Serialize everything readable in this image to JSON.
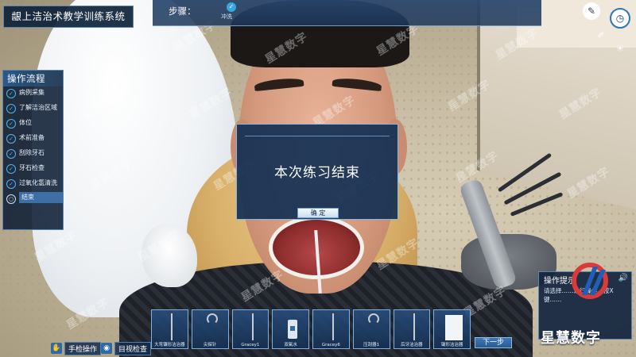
{
  "app": {
    "title": "龈上洁治术教学训练系统"
  },
  "steps": {
    "label": "步骤：",
    "current": "冲洗"
  },
  "procedure": {
    "title": "操作流程",
    "items": [
      {
        "label": "病例采集",
        "done": true
      },
      {
        "label": "了解洁治区域",
        "done": true
      },
      {
        "label": "体位",
        "done": true
      },
      {
        "label": "术前准备",
        "done": true
      },
      {
        "label": "刮除牙石",
        "done": true
      },
      {
        "label": "牙石检查",
        "done": true
      },
      {
        "label": "过氧化氢清洗",
        "done": true
      },
      {
        "label": "结束",
        "done": false,
        "active": true
      }
    ]
  },
  "dialog": {
    "message": "本次练习结束",
    "ok_label": "确 定"
  },
  "tip": {
    "title": "操作提示",
    "text": "请选择……进行操作，按X键……"
  },
  "brand": {
    "name": "星慧数字"
  },
  "tray": {
    "items": [
      {
        "label": "大弯镰形洁治器",
        "icon": "sickle-scaler-icon"
      },
      {
        "label": "尖探针",
        "icon": "probe-icon"
      },
      {
        "label": "Gracey1",
        "icon": "curette-icon"
      },
      {
        "label": "双氧水",
        "icon": "bottle-icon"
      },
      {
        "label": "Gracey6",
        "icon": "curette-icon"
      },
      {
        "label": "压刮器1",
        "icon": "scraper-icon"
      },
      {
        "label": "后牙洁治器",
        "icon": "scaler-icon"
      },
      {
        "label": "锄形洁治器",
        "icon": "hoe-scaler-icon"
      }
    ]
  },
  "buttons": {
    "next": "下一步",
    "hand_op": "手检操作",
    "visual": "目视检查"
  },
  "watermark": "星慧数字",
  "colors": {
    "panel": "#0e223a",
    "accent": "#36a9e1",
    "border": "#5a86b0"
  }
}
